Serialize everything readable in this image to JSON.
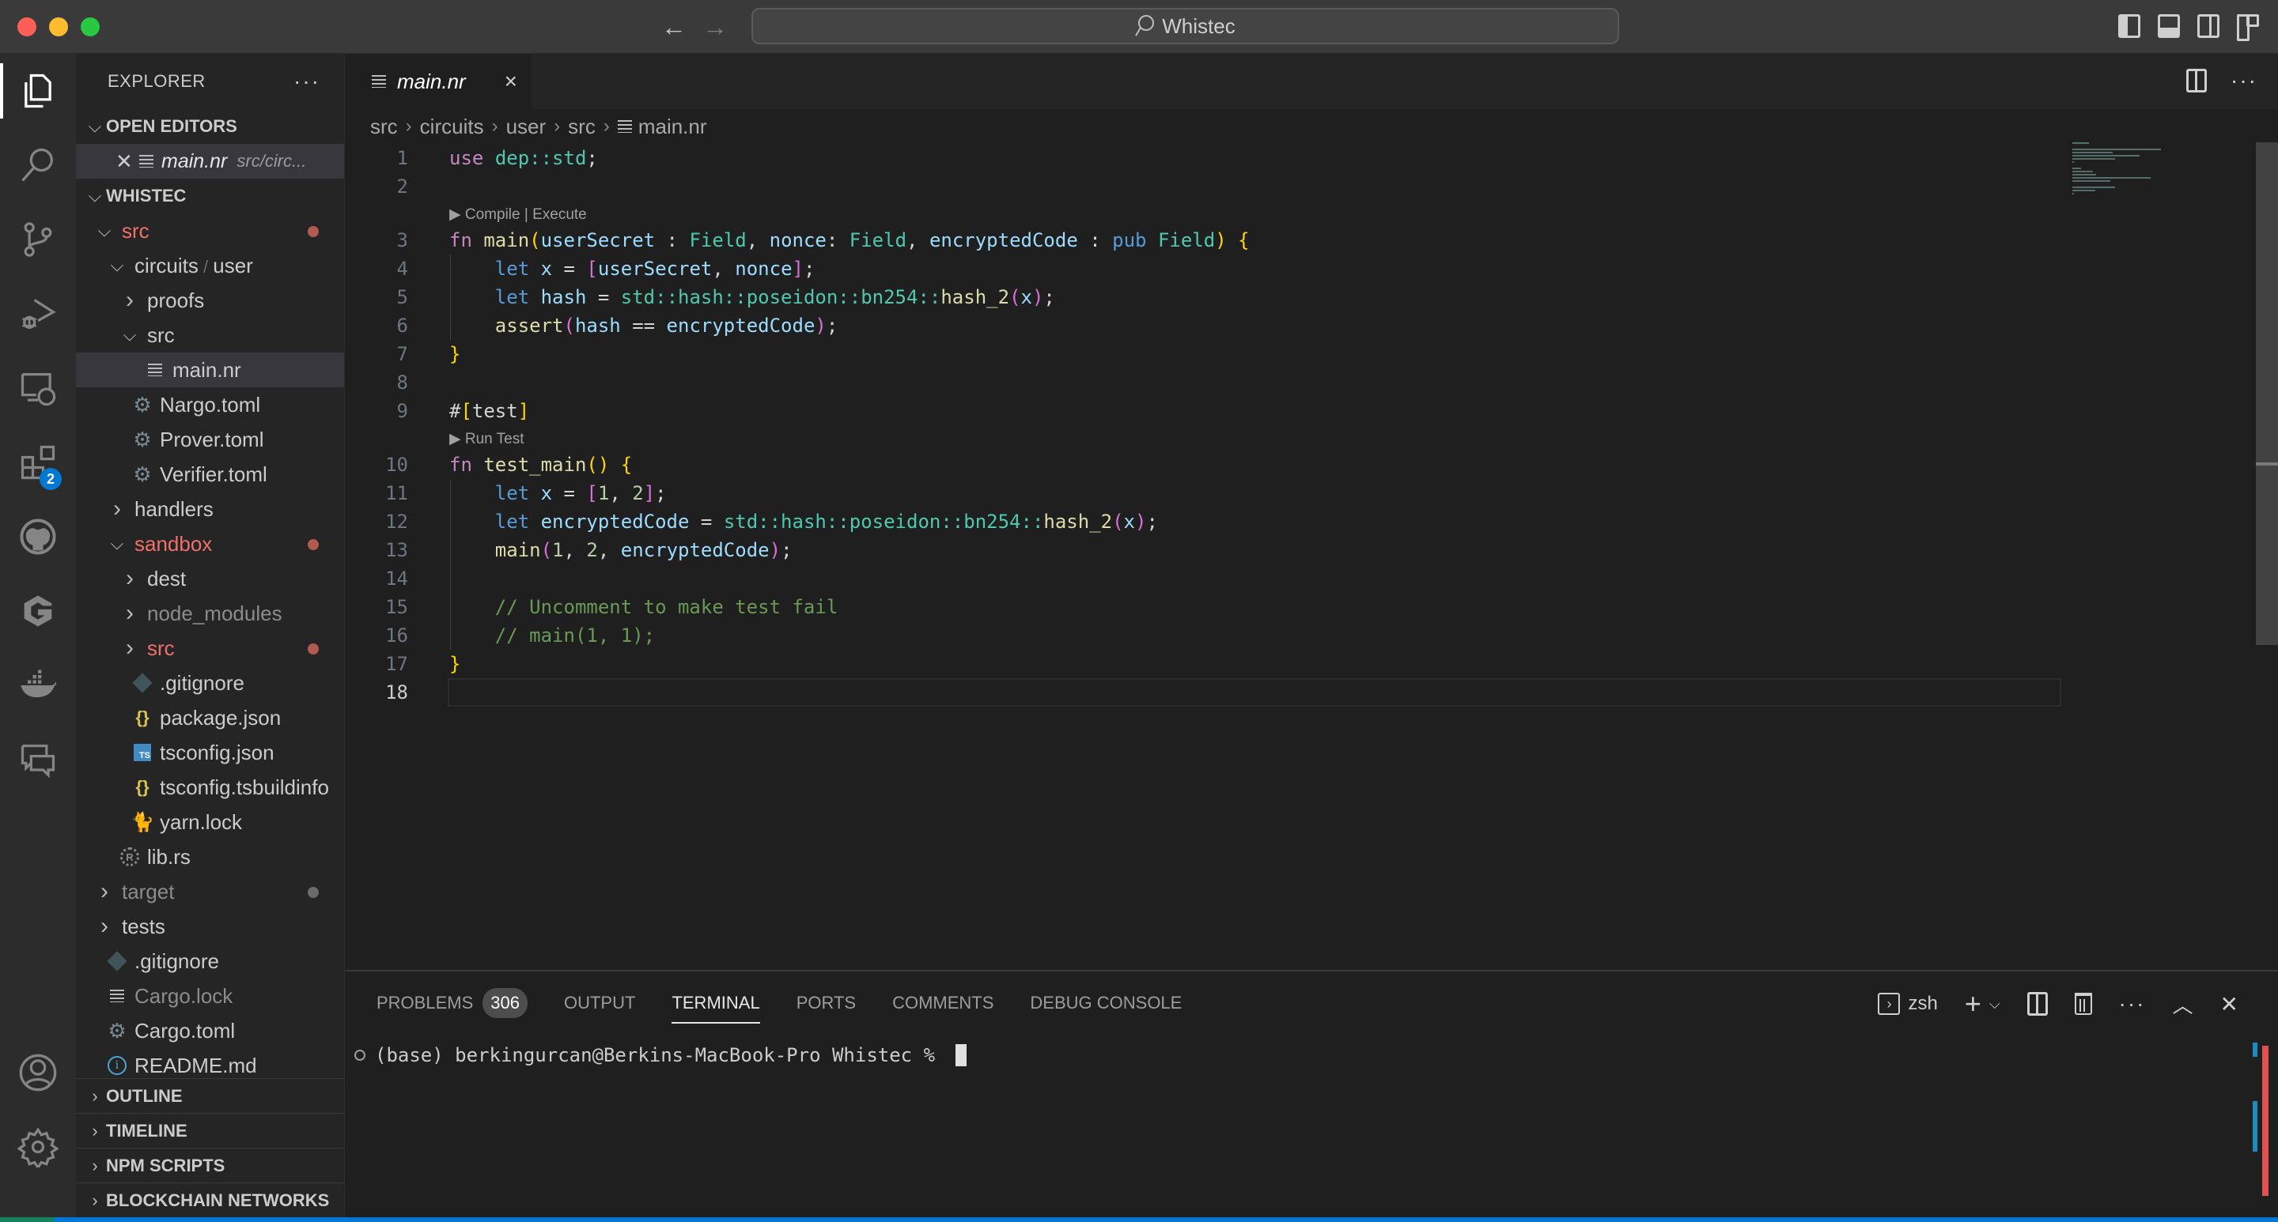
{
  "window": {
    "search_text": "Whistec",
    "nav_back_icon": "arrow-left-icon",
    "nav_forward_icon": "arrow-right-icon"
  },
  "activity_bar": {
    "items": [
      {
        "name": "explorer",
        "icon": "files-icon",
        "active": true
      },
      {
        "name": "search",
        "icon": "search-icon"
      },
      {
        "name": "source-control",
        "icon": "source-control-icon"
      },
      {
        "name": "run-debug",
        "icon": "run-debug-icon"
      },
      {
        "name": "remote-explorer",
        "icon": "remote-explorer-icon"
      },
      {
        "name": "extensions",
        "icon": "extensions-icon",
        "badge": "2"
      },
      {
        "name": "github",
        "icon": "github-icon"
      },
      {
        "name": "gitlens",
        "icon": "g-logo-icon"
      },
      {
        "name": "docker",
        "icon": "docker-icon"
      },
      {
        "name": "comments",
        "icon": "comments-icon"
      }
    ],
    "bottom": [
      {
        "name": "accounts",
        "icon": "account-icon"
      },
      {
        "name": "manage",
        "icon": "gear-icon"
      }
    ]
  },
  "sidebar": {
    "title": "EXPLORER",
    "more": "···",
    "open_editors": {
      "label": "OPEN EDITORS",
      "items": [
        {
          "name": "main.nr",
          "path": "src/circ..."
        }
      ]
    },
    "workspace": {
      "label": "WHISTEC",
      "tree": [
        {
          "label": "src",
          "depth": 0,
          "type": "folder-open",
          "status": "modified"
        },
        {
          "label": "circuits",
          "label2": "user",
          "depth": 1,
          "type": "folder-open"
        },
        {
          "label": "proofs",
          "depth": 2,
          "type": "folder-closed"
        },
        {
          "label": "src",
          "depth": 2,
          "type": "folder-open"
        },
        {
          "label": "main.nr",
          "depth": 3,
          "type": "file-lines",
          "selected": true
        },
        {
          "label": "Nargo.toml",
          "depth": 2,
          "type": "gear"
        },
        {
          "label": "Prover.toml",
          "depth": 2,
          "type": "gear"
        },
        {
          "label": "Verifier.toml",
          "depth": 2,
          "type": "gear"
        },
        {
          "label": "handlers",
          "depth": 1,
          "type": "folder-closed"
        },
        {
          "label": "sandbox",
          "depth": 1,
          "type": "folder-open",
          "status": "modified"
        },
        {
          "label": "dest",
          "depth": 2,
          "type": "folder-closed"
        },
        {
          "label": "node_modules",
          "depth": 2,
          "type": "folder-closed",
          "dim": true
        },
        {
          "label": "src",
          "depth": 2,
          "type": "folder-closed",
          "status": "modified"
        },
        {
          "label": ".gitignore",
          "depth": 2,
          "type": "git"
        },
        {
          "label": "package.json",
          "depth": 2,
          "type": "json"
        },
        {
          "label": "tsconfig.json",
          "depth": 2,
          "type": "ts"
        },
        {
          "label": "tsconfig.tsbuildinfo",
          "depth": 2,
          "type": "json"
        },
        {
          "label": "yarn.lock",
          "depth": 2,
          "type": "yarn"
        },
        {
          "label": "lib.rs",
          "depth": 1,
          "type": "rust"
        },
        {
          "label": "target",
          "depth": 0,
          "type": "folder-closed",
          "dim": true,
          "status": "ignored"
        },
        {
          "label": "tests",
          "depth": 0,
          "type": "folder-closed"
        },
        {
          "label": ".gitignore",
          "depth": 0,
          "type": "git"
        },
        {
          "label": "Cargo.lock",
          "depth": 0,
          "type": "file-lines",
          "dim": true
        },
        {
          "label": "Cargo.toml",
          "depth": 0,
          "type": "gear"
        },
        {
          "label": "README.md",
          "depth": 0,
          "type": "info"
        }
      ]
    },
    "sections": [
      "OUTLINE",
      "TIMELINE",
      "NPM SCRIPTS",
      "BLOCKCHAIN NETWORKS"
    ]
  },
  "editor": {
    "tab": {
      "name": "main.nr",
      "close": "×"
    },
    "breadcrumb": [
      "src",
      "circuits",
      "user",
      "src",
      "main.nr"
    ],
    "codelens": {
      "compile": "▶ Compile | Execute",
      "run_test": "▶ Run Test"
    },
    "current_line": 18,
    "lines": [
      {
        "n": 1,
        "tokens": [
          [
            "kw",
            "use"
          ],
          [
            "pl",
            " "
          ],
          [
            "ns",
            "dep::std"
          ],
          [
            "pl",
            ";"
          ]
        ]
      },
      {
        "n": 2,
        "tokens": []
      },
      {
        "n": 3,
        "tokens": [
          [
            "kw",
            "fn"
          ],
          [
            "pl",
            " "
          ],
          [
            "fn",
            "main"
          ],
          [
            "b1",
            "("
          ],
          [
            "var",
            "userSecret"
          ],
          [
            "pl",
            " : "
          ],
          [
            "ty",
            "Field"
          ],
          [
            "pl",
            ", "
          ],
          [
            "var",
            "nonce"
          ],
          [
            "pl",
            ": "
          ],
          [
            "ty",
            "Field"
          ],
          [
            "pl",
            ", "
          ],
          [
            "var",
            "encryptedCode"
          ],
          [
            "pl",
            " : "
          ],
          [
            "kw2",
            "pub"
          ],
          [
            "pl",
            " "
          ],
          [
            "ty",
            "Field"
          ],
          [
            "b1",
            ")"
          ],
          [
            "pl",
            " "
          ],
          [
            "b1",
            "{"
          ]
        ]
      },
      {
        "n": 4,
        "tokens": [
          [
            "pl",
            "    "
          ],
          [
            "kw2",
            "let"
          ],
          [
            "pl",
            " "
          ],
          [
            "var",
            "x"
          ],
          [
            "pl",
            " = "
          ],
          [
            "b2",
            "["
          ],
          [
            "var",
            "userSecret"
          ],
          [
            "pl",
            ", "
          ],
          [
            "var",
            "nonce"
          ],
          [
            "b2",
            "]"
          ],
          [
            "pl",
            ";"
          ]
        ]
      },
      {
        "n": 5,
        "tokens": [
          [
            "pl",
            "    "
          ],
          [
            "kw2",
            "let"
          ],
          [
            "pl",
            " "
          ],
          [
            "var",
            "hash"
          ],
          [
            "pl",
            " = "
          ],
          [
            "ns",
            "std::hash::poseidon::bn254::"
          ],
          [
            "fn",
            "hash_2"
          ],
          [
            "b2",
            "("
          ],
          [
            "var",
            "x"
          ],
          [
            "b2",
            ")"
          ],
          [
            "pl",
            ";"
          ]
        ]
      },
      {
        "n": 6,
        "tokens": [
          [
            "pl",
            "    "
          ],
          [
            "fn",
            "assert"
          ],
          [
            "b2",
            "("
          ],
          [
            "var",
            "hash"
          ],
          [
            "pl",
            " == "
          ],
          [
            "var",
            "encryptedCode"
          ],
          [
            "b2",
            ")"
          ],
          [
            "pl",
            ";"
          ]
        ]
      },
      {
        "n": 7,
        "tokens": [
          [
            "b1",
            "}"
          ]
        ]
      },
      {
        "n": 8,
        "tokens": []
      },
      {
        "n": 9,
        "tokens": [
          [
            "pl",
            "#"
          ],
          [
            "b1",
            "["
          ],
          [
            "pl",
            "test"
          ],
          [
            "b1",
            "]"
          ]
        ]
      },
      {
        "n": 10,
        "tokens": [
          [
            "kw",
            "fn"
          ],
          [
            "pl",
            " "
          ],
          [
            "fn",
            "test_main"
          ],
          [
            "b1",
            "()"
          ],
          [
            "pl",
            " "
          ],
          [
            "b1",
            "{"
          ]
        ]
      },
      {
        "n": 11,
        "tokens": [
          [
            "pl",
            "    "
          ],
          [
            "kw2",
            "let"
          ],
          [
            "pl",
            " "
          ],
          [
            "var",
            "x"
          ],
          [
            "pl",
            " = "
          ],
          [
            "b2",
            "["
          ],
          [
            "num",
            "1"
          ],
          [
            "pl",
            ", "
          ],
          [
            "num",
            "2"
          ],
          [
            "b2",
            "]"
          ],
          [
            "pl",
            ";"
          ]
        ]
      },
      {
        "n": 12,
        "tokens": [
          [
            "pl",
            "    "
          ],
          [
            "kw2",
            "let"
          ],
          [
            "pl",
            " "
          ],
          [
            "var",
            "encryptedCode"
          ],
          [
            "pl",
            " = "
          ],
          [
            "ns",
            "std::hash::poseidon::bn254::"
          ],
          [
            "fn",
            "hash_2"
          ],
          [
            "b2",
            "("
          ],
          [
            "var",
            "x"
          ],
          [
            "b2",
            ")"
          ],
          [
            "pl",
            ";"
          ]
        ]
      },
      {
        "n": 13,
        "tokens": [
          [
            "pl",
            "    "
          ],
          [
            "fn",
            "main"
          ],
          [
            "b2",
            "("
          ],
          [
            "num",
            "1"
          ],
          [
            "pl",
            ", "
          ],
          [
            "num",
            "2"
          ],
          [
            "pl",
            ", "
          ],
          [
            "var",
            "encryptedCode"
          ],
          [
            "b2",
            ")"
          ],
          [
            "pl",
            ";"
          ]
        ]
      },
      {
        "n": 14,
        "tokens": []
      },
      {
        "n": 15,
        "tokens": [
          [
            "pl",
            "    "
          ],
          [
            "cmt",
            "// Uncomment to make test fail"
          ]
        ]
      },
      {
        "n": 16,
        "tokens": [
          [
            "pl",
            "    "
          ],
          [
            "cmt",
            "// main(1, 1);"
          ]
        ]
      },
      {
        "n": 17,
        "tokens": [
          [
            "b1",
            "}"
          ]
        ]
      },
      {
        "n": 18,
        "tokens": []
      }
    ]
  },
  "panel": {
    "tabs": [
      {
        "label": "PROBLEMS",
        "badge": "306"
      },
      {
        "label": "OUTPUT"
      },
      {
        "label": "TERMINAL",
        "active": true
      },
      {
        "label": "PORTS"
      },
      {
        "label": "COMMENTS"
      },
      {
        "label": "DEBUG CONSOLE"
      }
    ],
    "terminal_name": "zsh",
    "prompt": "(base) berkingurcan@Berkins-MacBook-Pro Whistec % "
  },
  "colors": {
    "accent": "#0078d4",
    "modified": "#f0706a",
    "badge": "#0078d4"
  }
}
